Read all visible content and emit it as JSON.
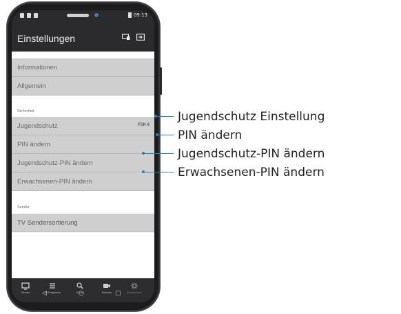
{
  "status_bar": {
    "time": "09:13"
  },
  "app_bar": {
    "title": "Einstellungen",
    "icons": [
      "cast-icon",
      "exit-icon"
    ]
  },
  "list": {
    "rows_top": [
      {
        "label": "Informationen"
      },
      {
        "label": "Allgemein"
      }
    ],
    "section_security": "Sicherheit",
    "security_rows": [
      {
        "label": "Jugendschutz",
        "value": "FSK 6"
      },
      {
        "label": "PIN ändern"
      },
      {
        "label": "Jugendschutz-PIN ändern"
      },
      {
        "label": "Erwachsenen-PIN ändern"
      }
    ],
    "section_sender": "Sender",
    "sender_rows": [
      {
        "label": "TV Sendersortierung"
      }
    ]
  },
  "bottom_nav": [
    {
      "label": "Sender",
      "icon": "tv-icon"
    },
    {
      "label": "TV-Programm",
      "icon": "list-icon"
    },
    {
      "label": "Suche",
      "icon": "search-icon"
    },
    {
      "label": "Berichte",
      "icon": "camera-icon"
    },
    {
      "label": "Einstellungen",
      "icon": "gear-icon"
    }
  ],
  "callouts": [
    "Jugendschutz Einstellung",
    "PIN ändern",
    "Jugendschutz-PIN ändern",
    "Erwachsenen-PIN ändern"
  ],
  "colors": {
    "callout": "#2e7bbf",
    "list_row": "#cfcfcf",
    "app_background": "#2b2b2d"
  }
}
